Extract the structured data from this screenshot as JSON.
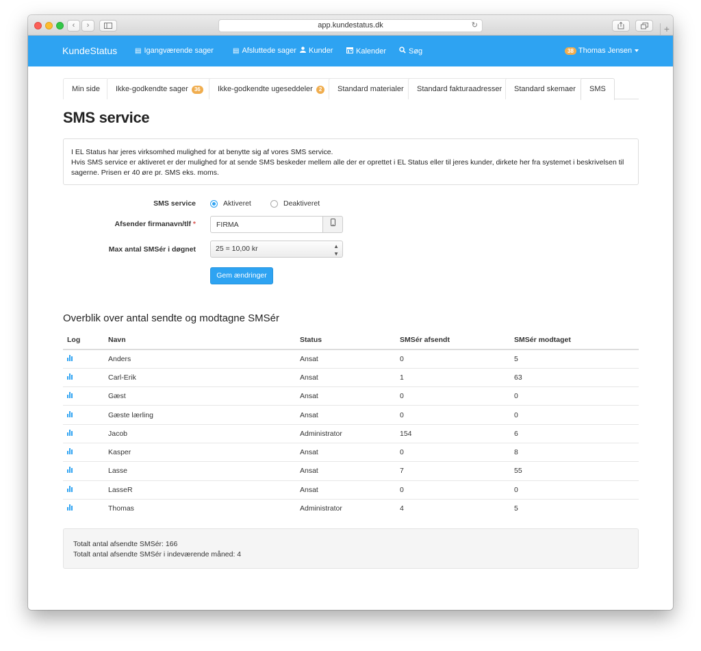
{
  "browser": {
    "url": "app.kundestatus.dk",
    "back_icon": "chevron-left-icon",
    "forward_icon": "chevron-right-icon",
    "sidebar_icon": "sidebar-icon",
    "reload_icon": "reload-icon",
    "share_icon": "share-icon",
    "tabs_icon": "tabs-icon",
    "plus_icon": "plus-icon"
  },
  "navbar": {
    "brand": "KundeStatus",
    "items": [
      {
        "label": "Igangværende sager",
        "icon": "list-icon"
      },
      {
        "label": "Afsluttede sager",
        "icon": "list-icon"
      },
      {
        "label": "Kunder",
        "icon": "user-icon"
      },
      {
        "label": "Kalender",
        "icon": "calendar-icon"
      },
      {
        "label": "Søg",
        "icon": "search-icon"
      }
    ],
    "user": {
      "badge": "38",
      "name": "Thomas Jensen"
    },
    "accent_color": "#2ea3f2"
  },
  "tabs": [
    {
      "label": "Min side",
      "badge": ""
    },
    {
      "label": "Ikke-godkendte sager",
      "badge": "36"
    },
    {
      "label": "Ikke-godkendte ugeseddeler",
      "badge": "2"
    },
    {
      "label": "Standard materialer",
      "badge": ""
    },
    {
      "label": "Standard fakturaadresser",
      "badge": ""
    },
    {
      "label": "Standard skemaer",
      "badge": ""
    },
    {
      "label": "SMS",
      "badge": "",
      "active": true
    }
  ],
  "page": {
    "title": "SMS service",
    "info_line1": "I EL Status har jeres virksomhed mulighed for at benytte sig af vores SMS service.",
    "info_line2": "Hvis SMS service er aktiveret er der mulighed for at sende SMS beskeder mellem alle der er oprettet i EL Status eller til jeres kunder, dirkete her fra systemet i beskrivelsen til sagerne. Prisen er 40 øre pr. SMS eks. moms."
  },
  "form": {
    "sms_service_label": "SMS service",
    "option_on": "Aktiveret",
    "option_off": "Deaktiveret",
    "selected": "Aktiveret",
    "sender_label": "Afsender firmanavn/tlf",
    "sender_required": "*",
    "sender_value": "FIRMA",
    "sender_icon": "mobile-phone-icon",
    "max_label": "Max antal SMSér i døgnet",
    "max_value": "25 = 10,00 kr",
    "save_label": "Gem ændringer"
  },
  "overview": {
    "title": "Overblik over antal sendte og modtagne SMSér",
    "columns": [
      "Log",
      "Navn",
      "Status",
      "SMSér afsendt",
      "SMSér modtaget"
    ],
    "log_icon": "bar-chart-icon",
    "rows": [
      {
        "name": "Anders",
        "status": "Ansat",
        "sent": "0",
        "received": "5"
      },
      {
        "name": "Carl-Erik",
        "status": "Ansat",
        "sent": "1",
        "received": "63"
      },
      {
        "name": "Gæst",
        "status": "Ansat",
        "sent": "0",
        "received": "0"
      },
      {
        "name": "Gæste lærling",
        "status": "Ansat",
        "sent": "0",
        "received": "0"
      },
      {
        "name": "Jacob",
        "status": "Administrator",
        "sent": "154",
        "received": "6"
      },
      {
        "name": "Kasper",
        "status": "Ansat",
        "sent": "0",
        "received": "8"
      },
      {
        "name": "Lasse",
        "status": "Ansat",
        "sent": "7",
        "received": "55"
      },
      {
        "name": "LasseR",
        "status": "Ansat",
        "sent": "0",
        "received": "0"
      },
      {
        "name": "Thomas",
        "status": "Administrator",
        "sent": "4",
        "received": "5"
      }
    ]
  },
  "summary": {
    "line1": "Totalt antal afsendte SMSér: 166",
    "line2": "Totalt antal afsendte SMSér i indeværende måned: 4"
  }
}
